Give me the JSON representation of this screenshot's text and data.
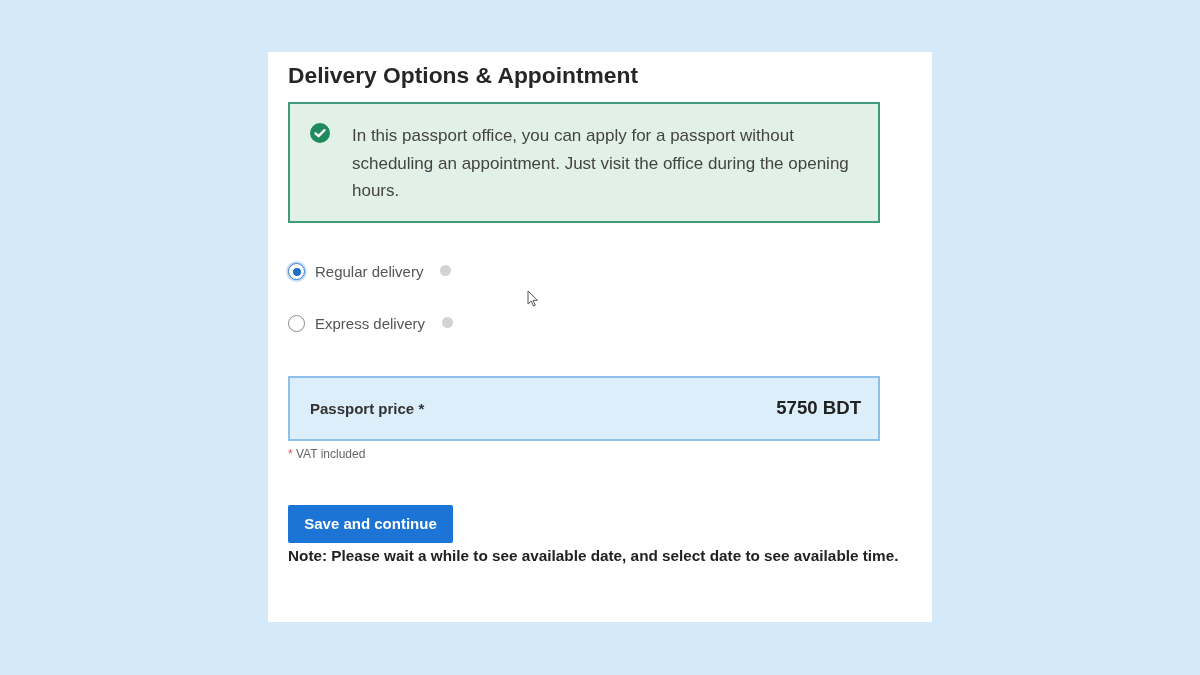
{
  "page_title": "Delivery Options & Appointment",
  "notice": {
    "text": "In this passport office, you can apply for a passport without scheduling an appointment. Just visit the office during the opening hours."
  },
  "delivery_options": [
    {
      "label": "Regular delivery",
      "selected": true
    },
    {
      "label": "Express delivery",
      "selected": false
    }
  ],
  "price": {
    "label": "Passport price *",
    "value": "5750 BDT"
  },
  "price_footnote": {
    "mark": "*",
    "text": "VAT included"
  },
  "primary_button": "Save and continue",
  "note": "Note: Please wait a while to see available date, and select date to see available time."
}
